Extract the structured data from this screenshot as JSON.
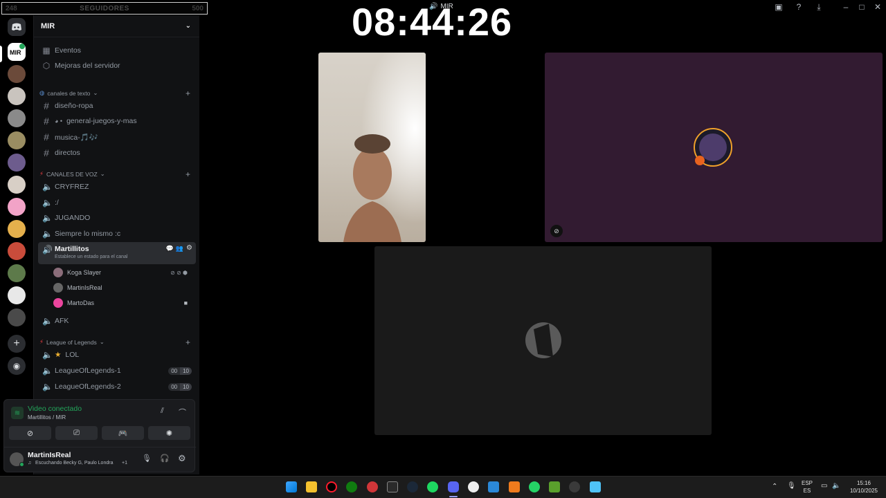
{
  "overlay": {
    "followers_current": "248",
    "followers_label": "SEGUIDORES",
    "followers_goal": "500",
    "clock": "08:44:26"
  },
  "window": {
    "title": "MIR"
  },
  "server": {
    "name": "MIR",
    "top_items": [
      {
        "label": "Eventos",
        "icon": "calendar-icon"
      },
      {
        "label": "Mejoras del servidor",
        "icon": "boost-icon"
      }
    ]
  },
  "text_category": {
    "label": "canales de texto",
    "channels": [
      "diseño-ropa",
      "general-juegos-y-mas",
      "musica-🎵🎶",
      "directos"
    ]
  },
  "voice_category": {
    "label": "CANALES DE VOZ",
    "channels": [
      "CRYFREZ",
      ":/",
      "JUGANDO",
      "Siempre lo mismo :c"
    ],
    "active_channel": "Martillitos",
    "active_status": "Establece un estado para el canal",
    "members": [
      "Koga Slayer",
      "MartinIsReal",
      "MartoDas"
    ],
    "after": "AFK"
  },
  "lol_category": {
    "label": "League of Legends",
    "channels": [
      {
        "name": "LOL",
        "counts": null
      },
      {
        "name": "LeagueOfLegends-1",
        "counts": [
          "00",
          "10"
        ]
      },
      {
        "name": "LeagueOfLegends-2",
        "counts": [
          "00",
          "10"
        ]
      }
    ]
  },
  "voice_panel": {
    "status": "Video conectado",
    "location": "Martillitos / MIR",
    "status_color": "#23a55a"
  },
  "user": {
    "name": "MartinIsReal",
    "activity": "Escuchando Becky G, Paulo Londra",
    "extra": "+1"
  },
  "tray": {
    "lang_top": "ESP",
    "lang_bottom": "ES",
    "time": "15:16",
    "date": "10/10/2025"
  },
  "colors": {
    "accent": "#5865f2",
    "stage_purple": "#321b31",
    "stage_gray": "#1a1a1a"
  }
}
